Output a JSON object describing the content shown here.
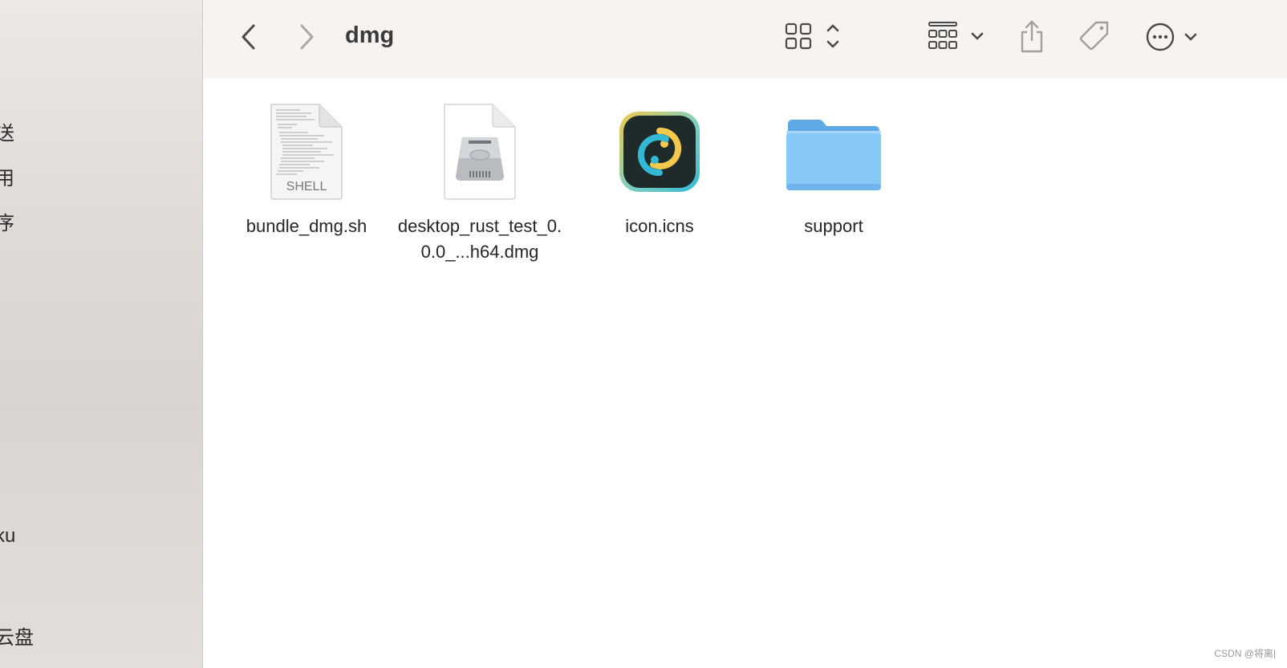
{
  "window": {
    "title": "dmg"
  },
  "sidebar": {
    "items": [
      {
        "label": "送"
      },
      {
        "label": "用"
      },
      {
        "label": "序"
      },
      {
        "label": "ku"
      },
      {
        "label": "云盘"
      }
    ]
  },
  "files": [
    {
      "name": "bundle_dmg.sh",
      "icon": "shell-script-icon",
      "badge": "SHELL"
    },
    {
      "name": "desktop_rust_test_0.0.0_...h64.dmg",
      "icon": "disk-image-icon"
    },
    {
      "name": "icon.icns",
      "icon": "app-icon"
    },
    {
      "name": "support",
      "icon": "folder-icon"
    }
  ],
  "watermark": "CSDN @将离|",
  "colors": {
    "folder": "#7cc2f2",
    "toolbar_bg": "#f7f3f1",
    "sidebar_bg": "#e3deda"
  }
}
